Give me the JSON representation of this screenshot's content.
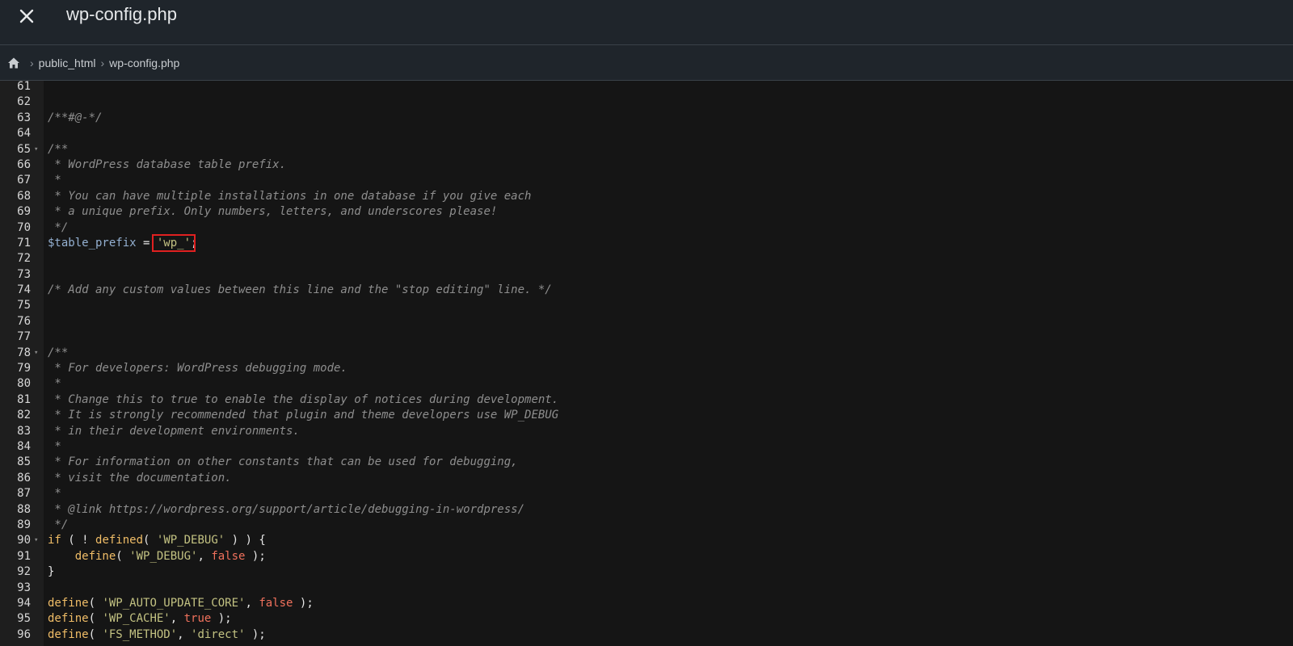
{
  "header": {
    "title": "wp-config.php",
    "close_icon": "close-icon"
  },
  "breadcrumb": {
    "home_icon": "home-icon",
    "items": [
      "public_html",
      "wp-config.php"
    ]
  },
  "editor": {
    "lines": [
      {
        "n": "61",
        "fold": false,
        "tokens": []
      },
      {
        "n": "62",
        "fold": false,
        "tokens": []
      },
      {
        "n": "63",
        "fold": false,
        "tokens": [
          {
            "t": "c",
            "v": "/**#@-*/"
          }
        ]
      },
      {
        "n": "64",
        "fold": false,
        "tokens": []
      },
      {
        "n": "65",
        "fold": true,
        "tokens": [
          {
            "t": "c",
            "v": "/**"
          }
        ]
      },
      {
        "n": "66",
        "fold": false,
        "tokens": [
          {
            "t": "c",
            "v": " * WordPress database table prefix."
          }
        ]
      },
      {
        "n": "67",
        "fold": false,
        "tokens": [
          {
            "t": "c",
            "v": " *"
          }
        ]
      },
      {
        "n": "68",
        "fold": false,
        "tokens": [
          {
            "t": "c",
            "v": " * You can have multiple installations in one database if you give each"
          }
        ]
      },
      {
        "n": "69",
        "fold": false,
        "tokens": [
          {
            "t": "c",
            "v": " * a unique prefix. Only numbers, letters, and underscores please!"
          }
        ]
      },
      {
        "n": "70",
        "fold": false,
        "tokens": [
          {
            "t": "c",
            "v": " */"
          }
        ]
      },
      {
        "n": "71",
        "fold": false,
        "tokens": [
          {
            "t": "v",
            "v": "$table_prefix"
          },
          {
            "t": "p",
            "v": " = "
          },
          {
            "t": "s",
            "v": "'wp_'",
            "hl": true
          },
          {
            "t": "p",
            "v": ";"
          }
        ]
      },
      {
        "n": "72",
        "fold": false,
        "tokens": []
      },
      {
        "n": "73",
        "fold": false,
        "tokens": []
      },
      {
        "n": "74",
        "fold": false,
        "tokens": [
          {
            "t": "c",
            "v": "/* Add any custom values between this line and the \"stop editing\" line. */"
          }
        ]
      },
      {
        "n": "75",
        "fold": false,
        "tokens": []
      },
      {
        "n": "76",
        "fold": false,
        "tokens": []
      },
      {
        "n": "77",
        "fold": false,
        "tokens": []
      },
      {
        "n": "78",
        "fold": true,
        "tokens": [
          {
            "t": "c",
            "v": "/**"
          }
        ]
      },
      {
        "n": "79",
        "fold": false,
        "tokens": [
          {
            "t": "c",
            "v": " * For developers: WordPress debugging mode."
          }
        ]
      },
      {
        "n": "80",
        "fold": false,
        "tokens": [
          {
            "t": "c",
            "v": " *"
          }
        ]
      },
      {
        "n": "81",
        "fold": false,
        "tokens": [
          {
            "t": "c",
            "v": " * Change this to true to enable the display of notices during development."
          }
        ]
      },
      {
        "n": "82",
        "fold": false,
        "tokens": [
          {
            "t": "c",
            "v": " * It is strongly recommended that plugin and theme developers use WP_DEBUG"
          }
        ]
      },
      {
        "n": "83",
        "fold": false,
        "tokens": [
          {
            "t": "c",
            "v": " * in their development environments."
          }
        ]
      },
      {
        "n": "84",
        "fold": false,
        "tokens": [
          {
            "t": "c",
            "v": " *"
          }
        ]
      },
      {
        "n": "85",
        "fold": false,
        "tokens": [
          {
            "t": "c",
            "v": " * For information on other constants that can be used for debugging,"
          }
        ]
      },
      {
        "n": "86",
        "fold": false,
        "tokens": [
          {
            "t": "c",
            "v": " * visit the documentation."
          }
        ]
      },
      {
        "n": "87",
        "fold": false,
        "tokens": [
          {
            "t": "c",
            "v": " *"
          }
        ]
      },
      {
        "n": "88",
        "fold": false,
        "tokens": [
          {
            "t": "c",
            "v": " * @link https://wordpress.org/support/article/debugging-in-wordpress/"
          }
        ]
      },
      {
        "n": "89",
        "fold": false,
        "tokens": [
          {
            "t": "c",
            "v": " */"
          }
        ]
      },
      {
        "n": "90",
        "fold": true,
        "tokens": [
          {
            "t": "k",
            "v": "if"
          },
          {
            "t": "p",
            "v": " ( ! "
          },
          {
            "t": "k",
            "v": "defined"
          },
          {
            "t": "p",
            "v": "( "
          },
          {
            "t": "s",
            "v": "'WP_DEBUG'"
          },
          {
            "t": "p",
            "v": " ) ) {"
          }
        ]
      },
      {
        "n": "91",
        "fold": false,
        "tokens": [
          {
            "t": "p",
            "v": "    "
          },
          {
            "t": "k",
            "v": "define"
          },
          {
            "t": "p",
            "v": "( "
          },
          {
            "t": "s",
            "v": "'WP_DEBUG'"
          },
          {
            "t": "p",
            "v": ", "
          },
          {
            "t": "b",
            "v": "false"
          },
          {
            "t": "p",
            "v": " );"
          }
        ]
      },
      {
        "n": "92",
        "fold": false,
        "tokens": [
          {
            "t": "p",
            "v": "}"
          }
        ]
      },
      {
        "n": "93",
        "fold": false,
        "tokens": []
      },
      {
        "n": "94",
        "fold": false,
        "tokens": [
          {
            "t": "k",
            "v": "define"
          },
          {
            "t": "p",
            "v": "( "
          },
          {
            "t": "s",
            "v": "'WP_AUTO_UPDATE_CORE'"
          },
          {
            "t": "p",
            "v": ", "
          },
          {
            "t": "b",
            "v": "false"
          },
          {
            "t": "p",
            "v": " );"
          }
        ]
      },
      {
        "n": "95",
        "fold": false,
        "tokens": [
          {
            "t": "k",
            "v": "define"
          },
          {
            "t": "p",
            "v": "( "
          },
          {
            "t": "s",
            "v": "'WP_CACHE'"
          },
          {
            "t": "p",
            "v": ", "
          },
          {
            "t": "b",
            "v": "true"
          },
          {
            "t": "p",
            "v": " );"
          }
        ]
      },
      {
        "n": "96",
        "fold": false,
        "tokens": [
          {
            "t": "k",
            "v": "define"
          },
          {
            "t": "p",
            "v": "( "
          },
          {
            "t": "s",
            "v": "'FS_METHOD'"
          },
          {
            "t": "p",
            "v": ", "
          },
          {
            "t": "s",
            "v": "'direct'"
          },
          {
            "t": "p",
            "v": " );"
          }
        ]
      }
    ]
  },
  "colors": {
    "highlight": "#e02020",
    "keyword": "#f0bd67",
    "string": "#c3c282",
    "variable": "#94b0d1",
    "boolean": "#f0715c",
    "comment": "#8e8e8e"
  }
}
